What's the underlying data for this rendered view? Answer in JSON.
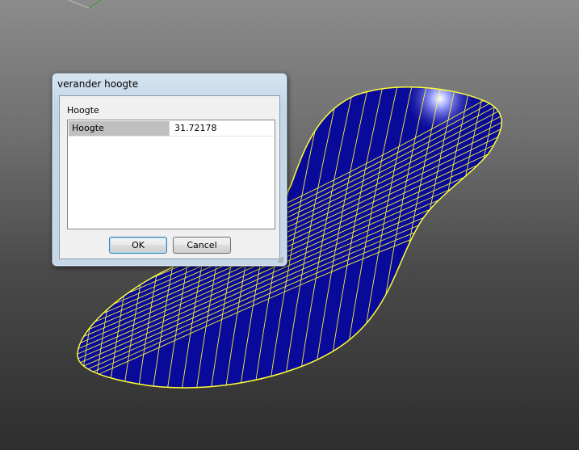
{
  "dialog": {
    "title": "verander hoogte",
    "group_label": "Hoogte",
    "properties": [
      {
        "name": "Hoogte",
        "value": "31.72178"
      }
    ],
    "ok_label": "OK",
    "cancel_label": "Cancel"
  },
  "scene": {
    "model": "insole-surface-mesh",
    "surface_color": "#0a0a9a",
    "wire_color": "#ffff33"
  }
}
